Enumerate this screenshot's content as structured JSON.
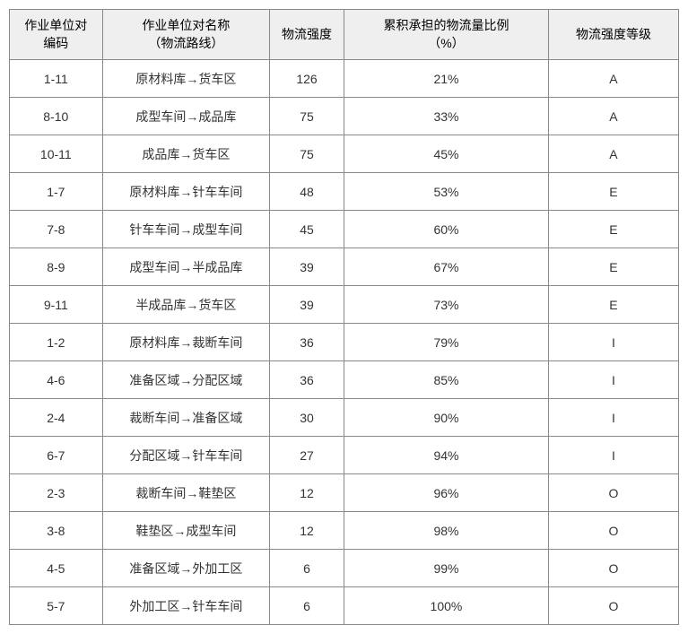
{
  "chart_data": {
    "type": "table",
    "title": "",
    "columns": [
      "作业单位对编码",
      "作业单位对名称（物流路线）",
      "物流强度",
      "累积承担的物流量比例（%）",
      "物流强度等级"
    ],
    "rows": [
      [
        "1-11",
        "原材料库→货车区",
        126,
        "21%",
        "A"
      ],
      [
        "8-10",
        "成型车间→成品库",
        75,
        "33%",
        "A"
      ],
      [
        "10-11",
        "成品库→货车区",
        75,
        "45%",
        "A"
      ],
      [
        "1-7",
        "原材料库→针车车间",
        48,
        "53%",
        "E"
      ],
      [
        "7-8",
        "针车车间→成型车间",
        45,
        "60%",
        "E"
      ],
      [
        "8-9",
        "成型车间→半成品库",
        39,
        "67%",
        "E"
      ],
      [
        "9-11",
        "半成品库→货车区",
        39,
        "73%",
        "E"
      ],
      [
        "1-2",
        "原材料库→裁断车间",
        36,
        "79%",
        "I"
      ],
      [
        "4-6",
        "准备区域→分配区域",
        36,
        "85%",
        "I"
      ],
      [
        "2-4",
        "裁断车间→准备区域",
        30,
        "90%",
        "I"
      ],
      [
        "6-7",
        "分配区域→针车车间",
        27,
        "94%",
        "I"
      ],
      [
        "2-3",
        "裁断车间→鞋垫区",
        12,
        "96%",
        "O"
      ],
      [
        "3-8",
        "鞋垫区→成型车间",
        12,
        "98%",
        "O"
      ],
      [
        "4-5",
        "准备区域→外加工区",
        6,
        "99%",
        "O"
      ],
      [
        "5-7",
        "外加工区→针车车间",
        6,
        "100%",
        "O"
      ]
    ]
  },
  "headers": {
    "col1_line1": "作业单位对",
    "col1_line2": "编码",
    "col2_line1": "作业单位对名称",
    "col2_line2": "（物流路线）",
    "col3": "物流强度",
    "col4_line1": "累积承担的物流量比例",
    "col4_line2": "（%）",
    "col5": "物流强度等级"
  },
  "rows": [
    {
      "code": "1-11",
      "name": "原材料库→货车区",
      "strength": "126",
      "percent": "21%",
      "grade": "A"
    },
    {
      "code": "8-10",
      "name": "成型车间→成品库",
      "strength": "75",
      "percent": "33%",
      "grade": "A"
    },
    {
      "code": "10-11",
      "name": "成品库→货车区",
      "strength": "75",
      "percent": "45%",
      "grade": "A"
    },
    {
      "code": "1-7",
      "name": "原材料库→针车车间",
      "strength": "48",
      "percent": "53%",
      "grade": "E"
    },
    {
      "code": "7-8",
      "name": "针车车间→成型车间",
      "strength": "45",
      "percent": "60%",
      "grade": "E"
    },
    {
      "code": "8-9",
      "name": "成型车间→半成品库",
      "strength": "39",
      "percent": "67%",
      "grade": "E"
    },
    {
      "code": "9-11",
      "name": "半成品库→货车区",
      "strength": "39",
      "percent": "73%",
      "grade": "E"
    },
    {
      "code": "1-2",
      "name": "原材料库→裁断车间",
      "strength": "36",
      "percent": "79%",
      "grade": "I"
    },
    {
      "code": "4-6",
      "name": "准备区域→分配区域",
      "strength": "36",
      "percent": "85%",
      "grade": "I"
    },
    {
      "code": "2-4",
      "name": "裁断车间→准备区域",
      "strength": "30",
      "percent": "90%",
      "grade": "I"
    },
    {
      "code": "6-7",
      "name": "分配区域→针车车间",
      "strength": "27",
      "percent": "94%",
      "grade": "I"
    },
    {
      "code": "2-3",
      "name": "裁断车间→鞋垫区",
      "strength": "12",
      "percent": "96%",
      "grade": "O"
    },
    {
      "code": "3-8",
      "name": "鞋垫区→成型车间",
      "strength": "12",
      "percent": "98%",
      "grade": "O"
    },
    {
      "code": "4-5",
      "name": "准备区域→外加工区",
      "strength": "6",
      "percent": "99%",
      "grade": "O"
    },
    {
      "code": "5-7",
      "name": "外加工区→针车车间",
      "strength": "6",
      "percent": "100%",
      "grade": "O"
    }
  ]
}
